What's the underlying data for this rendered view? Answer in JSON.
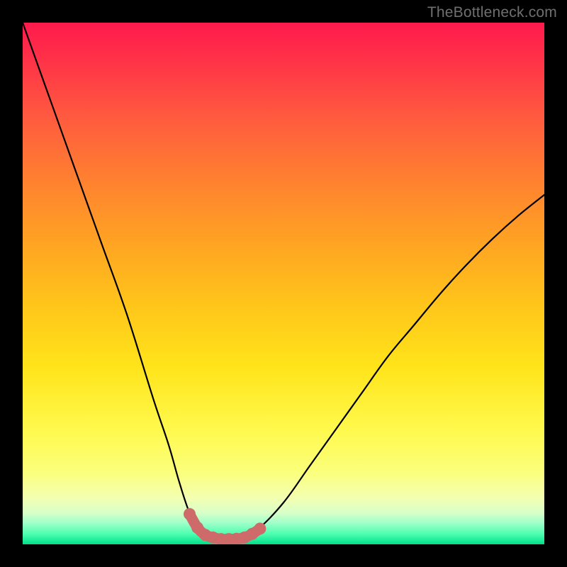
{
  "watermark": "TheBottleneck.com",
  "colors": {
    "page_bg": "#000000",
    "curve_stroke": "#000000",
    "marker_fill": "#cf6a6a",
    "gradient_top": "#ff1a4d",
    "gradient_mid": "#ffe41a",
    "gradient_bottom": "#00e18a"
  },
  "chart_data": {
    "type": "line",
    "title": "",
    "xlabel": "",
    "ylabel": "",
    "xlim": [
      0,
      100
    ],
    "ylim": [
      0,
      100
    ],
    "grid": false,
    "legend": false,
    "series": [
      {
        "name": "bottleneck-curve",
        "x": [
          0,
          5,
          10,
          15,
          20,
          25,
          28,
          30,
          32,
          34,
          36,
          38,
          40,
          42,
          45,
          50,
          55,
          60,
          65,
          70,
          75,
          80,
          85,
          90,
          95,
          100
        ],
        "values": [
          100,
          86,
          72,
          58,
          44,
          28,
          19,
          12,
          6,
          2.5,
          1.2,
          1,
          1,
          1.2,
          2.8,
          8,
          15,
          22,
          29,
          36,
          42,
          48,
          53.5,
          58.5,
          63,
          67
        ]
      }
    ],
    "markers": {
      "name": "bottom-markers",
      "x": [
        32,
        33.5,
        35,
        36.5,
        38,
        39.5,
        41,
        42.5,
        44,
        45.5
      ],
      "values": [
        5.8,
        3.2,
        1.8,
        1.3,
        1.0,
        1.0,
        1.05,
        1.3,
        2.0,
        3.0
      ]
    }
  }
}
